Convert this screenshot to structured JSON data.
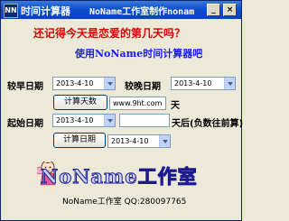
{
  "window": {
    "title": "时间计算器",
    "marquee": "NoName工作室制作nonam",
    "app_icon": "NN",
    "min_glyph": "_",
    "close_glyph": "×"
  },
  "headline": {
    "line1": "还记得今天是恋爱的第几天吗？",
    "line2": "使用NoName时间计算器吧"
  },
  "form": {
    "early_date_label": "较早日期",
    "early_date_value": "2013-4-10",
    "late_date_label": "较晚日期",
    "late_date_value": "2013-4-10",
    "calc_days_button": "计算天数",
    "days_result_value": "www.9ht.com",
    "days_unit": "天",
    "start_date_label": "起始日期",
    "start_date_value": "2013-4-10",
    "offset_value": "",
    "offset_unit": "天后(负数往前算)",
    "calc_date_button": "计算日期",
    "result_date_value": "2013-4-10"
  },
  "brand": {
    "logo_text": "NoName工作室"
  },
  "footer": {
    "text": "NoName工作室 QQ:280097765"
  },
  "colors": {
    "titlebar": "#0a4fcf",
    "headline1": "#e00000",
    "headline2": "#1a1aff"
  }
}
